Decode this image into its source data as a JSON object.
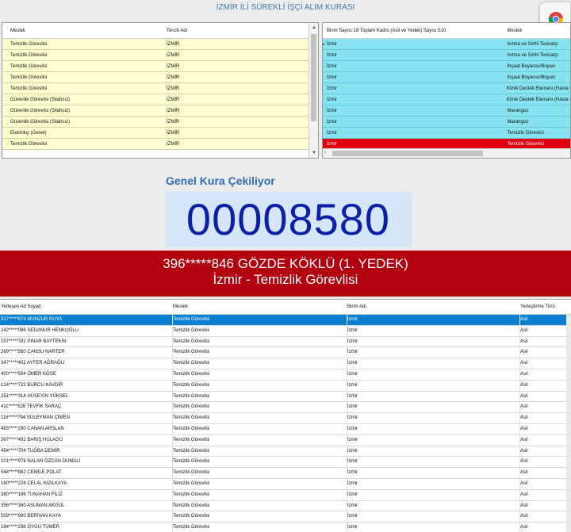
{
  "page_title": "İZMİR İLİ SÜREKLİ İŞÇİ ALIM KURASI",
  "browser_badge_icon": "chrome-icon",
  "left_panel": {
    "headers": [
      "Meslek",
      "Tercih Adı"
    ],
    "rows": [
      [
        "Temizlik Görevlisi",
        "İZMİR"
      ],
      [
        "Temizlik Görevlisi",
        "İZMİR"
      ],
      [
        "Temizlik Görevlisi",
        "İZMİR"
      ],
      [
        "Temizlik Görevlisi",
        "İZMİR"
      ],
      [
        "Temizlik Görevlisi",
        "İZMİR"
      ],
      [
        "Güvenlik Görevlisi (Silahsız)",
        "İZMİR"
      ],
      [
        "Güvenlik Görevlisi (Silahsız)",
        "İZMİR"
      ],
      [
        "Güvenlik Görevlisi (Silahsız)",
        "İZMİR"
      ],
      [
        "Elektrikçi (Genel)",
        "İZMİR"
      ],
      [
        "Temizlik Görevlisi",
        "İZMİR"
      ]
    ]
  },
  "right_panel": {
    "headers": [
      "Birim Sayısı:18 Toplam Kadro (Asil ve Yedek) Sayısı:510",
      "Meslek"
    ],
    "rows": [
      [
        "İzmir",
        "Isıtma ve Sıhhi Tesisatçı"
      ],
      [
        "İzmir",
        "Isıtma ve Sıhhi Tesisatçı"
      ],
      [
        "İzmir",
        "İnşaat Boyacısı/Boyacı"
      ],
      [
        "İzmir",
        "İnşaat Boyacısı/Boyacı"
      ],
      [
        "İzmir",
        "Klinik Destek Elemanı (Hasta ve Yaşlı Refakat)"
      ],
      [
        "İzmir",
        "Klinik Destek Elemanı (Hasta ve Yaşlı Refakat)"
      ],
      [
        "İzmir",
        "Marangoz"
      ],
      [
        "İzmir",
        "Marangoz"
      ],
      [
        "İzmir",
        "Temizlik Görevlisi"
      ],
      [
        "İzmir",
        "Temizlik Görevlisi"
      ]
    ],
    "highlight_row": 9,
    "highlight_color": "#e10010"
  },
  "draw": {
    "label": "Genel Kura Çekiliyor",
    "number": "00008580"
  },
  "banner": {
    "line1": "396*****846 GÖZDE KÖKLÜ (1. YEDEK)",
    "line2": "İzmir - Temizlik Görevlisi",
    "color": "#b3000f"
  },
  "results": {
    "headers": [
      "Yerleşen Ad Soyad",
      "Meslek",
      "Birim Adı",
      "Yerleştirme Türü"
    ],
    "selected_row": 0,
    "selected_color": "#0a7fd0",
    "rows": [
      [
        "317*****674 MUNZUR RUYA",
        "Temizlik Görevlisi",
        "İzmir",
        "Asil"
      ],
      [
        "242*****096 SEDANUR HENKOĞLU",
        "Temizlik Görevlisi",
        "İzmir",
        "Asil"
      ],
      [
        "157*****782 PINAR BAYTEKİN",
        "Temizlik Görevlisi",
        "İzmir",
        "Asil"
      ],
      [
        "269*****560 CANSU NARTER",
        "Temizlik Görevlisi",
        "İzmir",
        "Asil"
      ],
      [
        "347*****402 AYFER AĞRAĞLI",
        "Temizlik Görevlisi",
        "İzmir",
        "Asil"
      ],
      [
        "400*****584 ÖMER KÖSE",
        "Temizlik Görevlisi",
        "İzmir",
        "Asil"
      ],
      [
        "124*****722 BURCU KAVDIR",
        "Temizlik Görevlisi",
        "İzmir",
        "Asil"
      ],
      [
        "251*****314 HÜSEYİN YÜKSEL",
        "Temizlik Görevlisi",
        "İzmir",
        "Asil"
      ],
      [
        "411*****526 TEVFİK SARAÇ",
        "Temizlik Görevlisi",
        "İzmir",
        "Asil"
      ],
      [
        "116*****784 SÜLEYMAN ÇİMEN",
        "Temizlik Görevlisi",
        "İzmir",
        "Asil"
      ],
      [
        "483*****290 CANAN ARSLAN",
        "Temizlik Görevlisi",
        "İzmir",
        "Asil"
      ],
      [
        "367*****492 BARIŞ HÜLAGÜ",
        "Temizlik Görevlisi",
        "İzmir",
        "Asil"
      ],
      [
        "454*****704 TUĞBA DEMİR",
        "Temizlik Görevlisi",
        "İzmir",
        "Asil"
      ],
      [
        "101*****978 NALAN ÖZCAN DUMALI",
        "Temizlik Görevlisi",
        "İzmir",
        "Asil"
      ],
      [
        "544*****882 CEMİLE POLAT",
        "Temizlik Görevlisi",
        "İzmir",
        "Asil"
      ],
      [
        "160*****226 CELAL KIZILKAYA",
        "Temizlik Görevlisi",
        "İzmir",
        "Asil"
      ],
      [
        "380*****186 TUNAHAN FİLİZ",
        "Temizlik Görevlisi",
        "İzmir",
        "Asil"
      ],
      [
        "356*****360 ASUMAN AKGÜL",
        "Temizlik Görevlisi",
        "İzmir",
        "Asil"
      ],
      [
        "509*****990 BERİVAN KAYA",
        "Temizlik Görevlisi",
        "İzmir",
        "Asil"
      ],
      [
        "164*****296 ÖYGÜ TÜMER",
        "Temizlik Görevlisi",
        "İzmir",
        "Asil"
      ]
    ]
  }
}
